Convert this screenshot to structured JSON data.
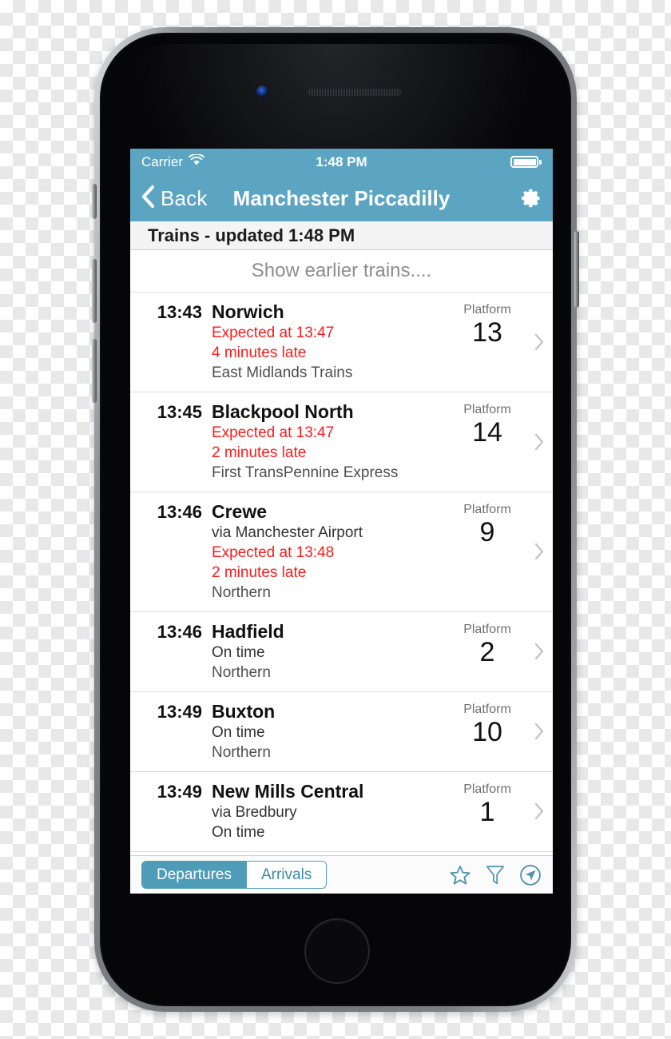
{
  "colors": {
    "brand_blue": "#5ba5c2",
    "segment_blue": "#4f9cb9",
    "late_red": "#ff1a1a",
    "muted_gray": "#8d8d8d",
    "screen_bg": "#ffffff"
  },
  "status_bar": {
    "carrier": "Carrier",
    "wifi_icon": "wifi-icon",
    "time": "1:48 PM",
    "battery_icon": "battery-full-icon"
  },
  "nav_bar": {
    "back_label": "Back",
    "back_icon": "chevron-left-icon",
    "title": "Manchester Piccadilly",
    "settings_icon": "gear-icon"
  },
  "section_header": {
    "text": "Trains - updated 1:48 PM"
  },
  "show_earlier": {
    "label": "Show earlier trains...."
  },
  "list": {
    "platform_label": "Platform",
    "rows": [
      {
        "time": "13:43",
        "destination": "Norwich",
        "via": "",
        "status": "Expected at 13:47",
        "status_late": true,
        "delay": "4 minutes late",
        "operator": "East Midlands Trains",
        "platform": "13"
      },
      {
        "time": "13:45",
        "destination": "Blackpool North",
        "via": "",
        "status": "Expected at 13:47",
        "status_late": true,
        "delay": "2 minutes late",
        "operator": "First TransPennine Express",
        "platform": "14"
      },
      {
        "time": "13:46",
        "destination": "Crewe",
        "via": "via Manchester Airport",
        "status": "Expected at 13:48",
        "status_late": true,
        "delay": "2 minutes late",
        "operator": "Northern",
        "platform": "9"
      },
      {
        "time": "13:46",
        "destination": "Hadfield",
        "via": "",
        "status": "On time",
        "status_late": false,
        "delay": "",
        "operator": "Northern",
        "platform": "2"
      },
      {
        "time": "13:49",
        "destination": "Buxton",
        "via": "",
        "status": "On time",
        "status_late": false,
        "delay": "",
        "operator": "Northern",
        "platform": "10"
      },
      {
        "time": "13:49",
        "destination": "New Mills Central",
        "via": "via Bredbury",
        "status": "On time",
        "status_late": false,
        "delay": "",
        "operator": "",
        "platform": "1"
      }
    ]
  },
  "toolbar": {
    "segments": [
      {
        "label": "Departures",
        "active": true
      },
      {
        "label": "Arrivals",
        "active": false
      }
    ],
    "icons": [
      {
        "name": "star-icon"
      },
      {
        "name": "filter-funnel-icon"
      },
      {
        "name": "location-arrow-icon"
      }
    ]
  }
}
